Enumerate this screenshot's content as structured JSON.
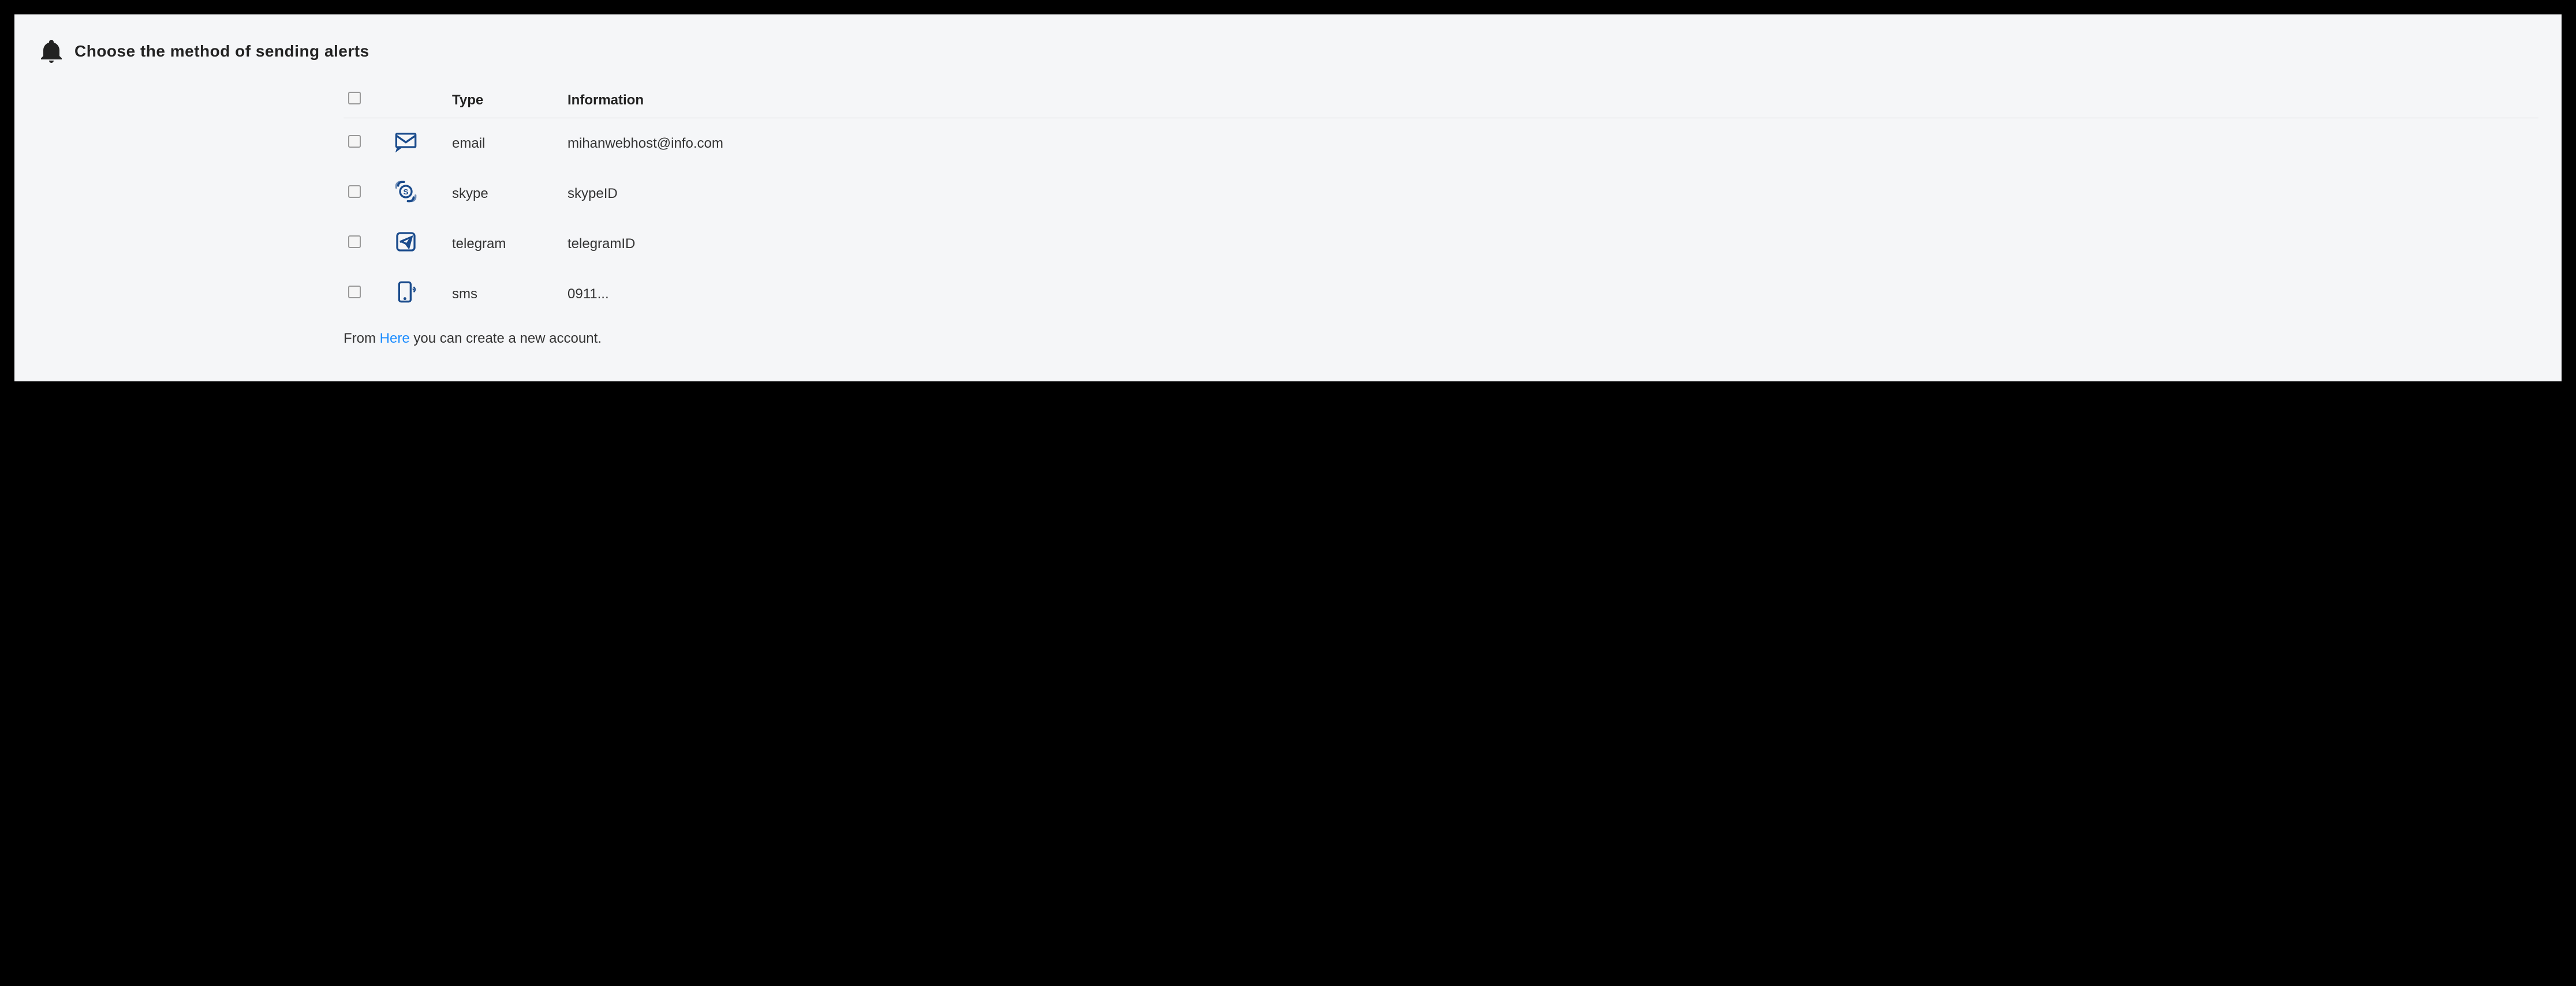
{
  "heading": "Choose the method of sending alerts",
  "table": {
    "headers": {
      "type": "Type",
      "information": "Information"
    },
    "rows": [
      {
        "icon": "email-icon",
        "type": "email",
        "info": "mihanwebhost@info.com"
      },
      {
        "icon": "skype-icon",
        "type": "skype",
        "info": "skypeID"
      },
      {
        "icon": "telegram-icon",
        "type": "telegram",
        "info": "telegramID"
      },
      {
        "icon": "sms-icon",
        "type": "sms",
        "info": "0911..."
      }
    ]
  },
  "footer": {
    "prefix": "From ",
    "link": "Here",
    "suffix": " you can create a new account."
  },
  "colors": {
    "iconStroke": "#1a4b8c",
    "linkColor": "#1a8cff"
  }
}
